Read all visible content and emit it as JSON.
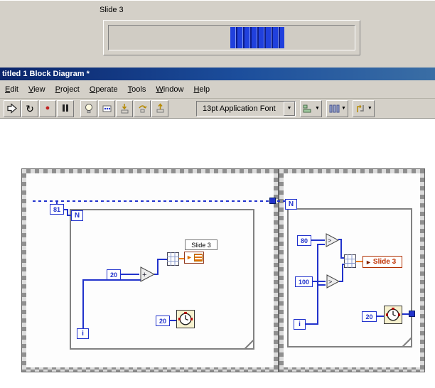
{
  "colors": {
    "panel_gray": "#d4d0c8",
    "titlebar_blue": "#0a246a",
    "wire_blue": "#2233cc",
    "wire_orange": "#ee7d00",
    "slider_fill_blue": "#2040dd",
    "local_variable_red": "#c03000"
  },
  "icons": {
    "run_continuous": "↻",
    "abort": "●",
    "dropdown_arrow": "▼",
    "local_write_arrow": "►"
  },
  "front_panel": {
    "slider_label": "Slide 3"
  },
  "window": {
    "title": "titled 1 Block Diagram *"
  },
  "menu": {
    "items": [
      "Edit",
      "View",
      "Project",
      "Operate",
      "Tools",
      "Window",
      "Help"
    ]
  },
  "toolbar": {
    "font_selector": "13pt Application Font"
  },
  "diagram": {
    "frame_left": {
      "loop_count_constant": "81",
      "count_terminal": "N",
      "iteration_terminal": "i",
      "add_constant": "20",
      "add_operator": "+",
      "local_variable_label": "Slide 3",
      "wait_constant": "20"
    },
    "frame_right": {
      "count_terminal": "N",
      "iteration_terminal": "i",
      "upper_constant": "80",
      "upper_operator": ">",
      "lower_constant": "100",
      "lower_operator": ">",
      "local_variable_label": "Slide 3",
      "wait_constant": "20"
    }
  }
}
